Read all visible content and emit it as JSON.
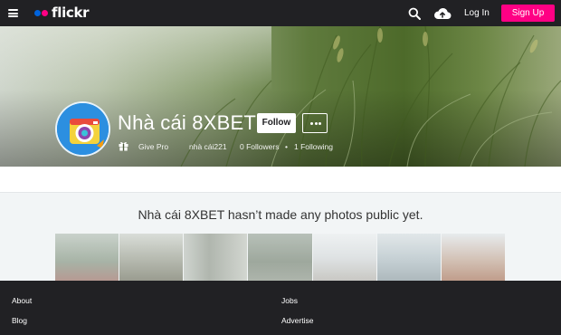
{
  "header": {
    "logo_text": "flickr",
    "icons": [
      "menu-icon",
      "search-icon",
      "upload-cloud-icon"
    ],
    "login_label": "Log In",
    "signup_label": "Sign Up",
    "colors": {
      "bar": "#212124",
      "brand_blue": "#0063dc",
      "brand_pink": "#ff0084"
    }
  },
  "profile": {
    "name": "Nhà cái 8XBET",
    "follow_label": "Follow",
    "give_pro_label": "Give Pro",
    "username": "nhà cái221",
    "followers": "0 Followers",
    "separator": "•",
    "following": "1 Following"
  },
  "main": {
    "empty_message": "Nhà cái 8XBET hasn’t made any photos public yet."
  },
  "footer": {
    "links": [
      "About",
      "Jobs",
      "Blog",
      "Advertise"
    ]
  }
}
